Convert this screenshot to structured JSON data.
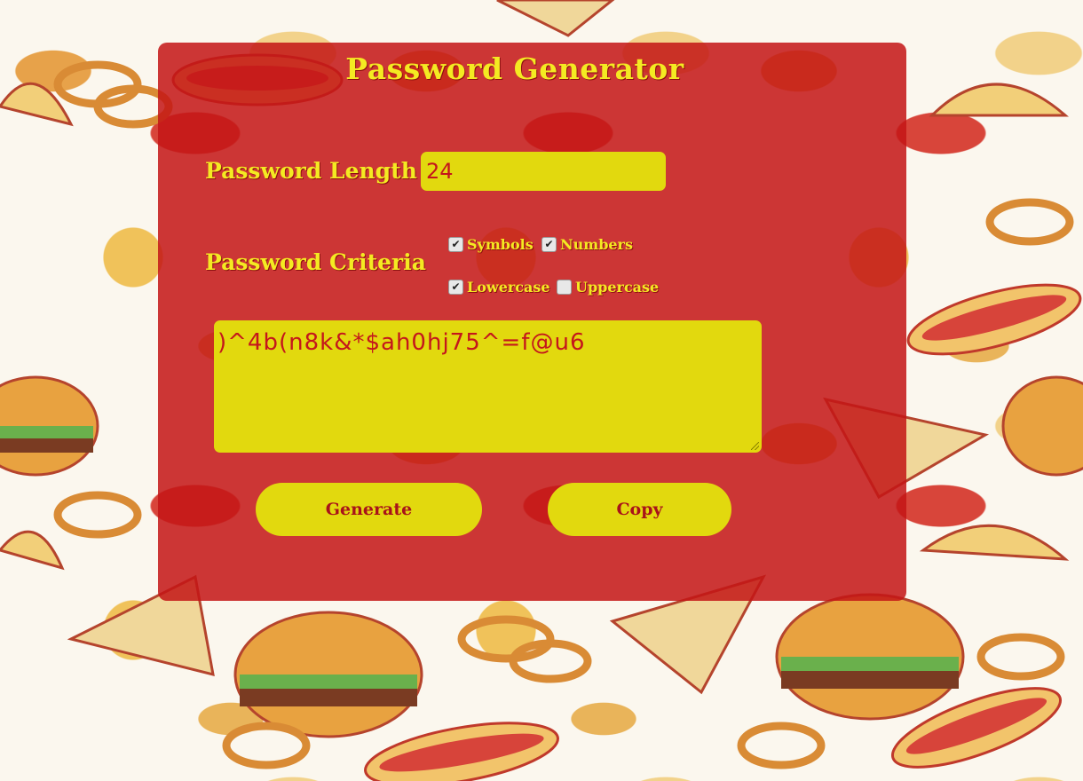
{
  "app": {
    "title": "Password Generator"
  },
  "length": {
    "label": "Password Length",
    "value": "24"
  },
  "criteria": {
    "label": "Password Criteria",
    "options": [
      {
        "label": "Symbols",
        "checked": true
      },
      {
        "label": "Numbers",
        "checked": true
      },
      {
        "label": "Lowercase",
        "checked": true
      },
      {
        "label": "Uppercase",
        "checked": false
      }
    ]
  },
  "output": {
    "password": ")^4b(n8k&*$ah0hj75^=f@u6"
  },
  "buttons": {
    "generate": "Generate",
    "copy": "Copy"
  },
  "colors": {
    "panel": "#c4161c",
    "accent": "#e2d90e",
    "label_text": "#f4ea22"
  }
}
